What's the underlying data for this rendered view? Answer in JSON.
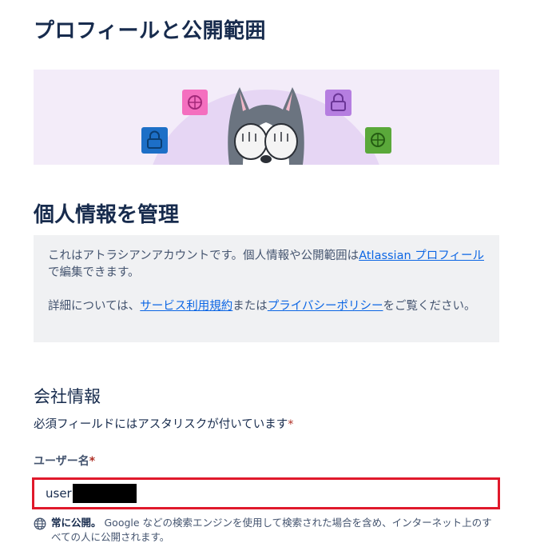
{
  "header": {
    "title": "プロフィールと公開範囲"
  },
  "section": {
    "title": "個人情報を管理"
  },
  "info": {
    "line1_text": "これはアトラシアンアカウントです。個人情報や公開範囲は",
    "line1_link": "Atlassian プロフィール",
    "line1_suffix": "で編集できます。",
    "line2_prefix": "詳細については、",
    "line2_link1": "サービス利用規約",
    "line2_mid": "または",
    "line2_link2": "プライバシーポリシー",
    "line2_suffix": "をご覧ください。"
  },
  "company": {
    "title": "会社情報",
    "required_note": "必須フィールドにはアスタリスクが付いています",
    "required_mark": "*"
  },
  "username": {
    "label": "ユーザー名",
    "required_mark": "*",
    "value": "user"
  },
  "visibility": {
    "strong": "常に公開。",
    "text": " Google などの検索エンジンを使用して検索された場合を含め、インターネット上のすべての人に公開されます。",
    "icon": "globe-icon"
  },
  "colors": {
    "text": "#172b4d",
    "subtle_text": "#44546f",
    "link": "#0c66e4",
    "required": "#ae2e24",
    "highlight_border": "#e0192b",
    "hero_bg": "#f3ecf9",
    "info_bg": "#f0f1f3"
  }
}
